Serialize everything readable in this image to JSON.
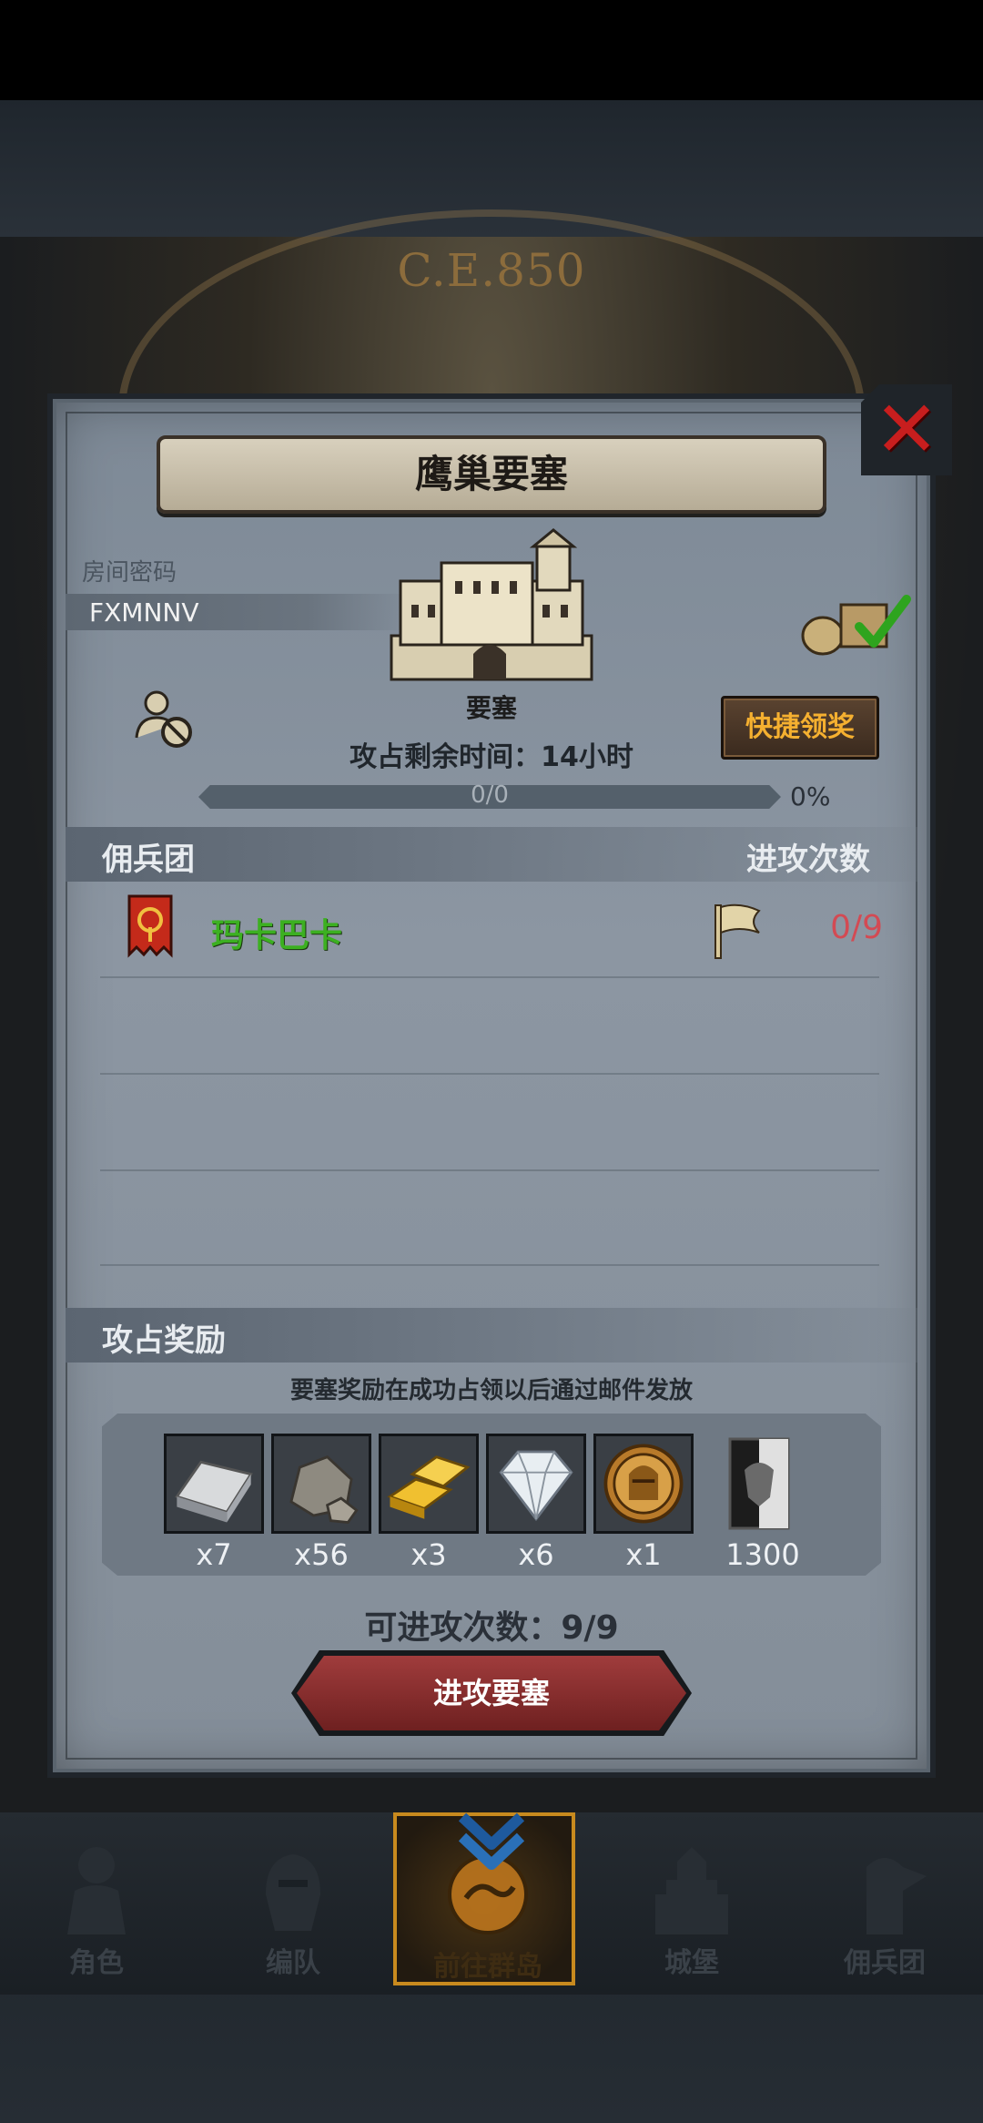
{
  "header": {
    "era": "C.E.850"
  },
  "modal": {
    "title": "鹰巢要塞",
    "room_label": "房间密码",
    "room_code": "FXMNNV",
    "fortress_label": "要塞",
    "quick_claim": "快捷领奖",
    "time_left": "攻占剩余时间：14小时",
    "progress": {
      "text": "0/0",
      "percent": "0%",
      "fraction": 0
    }
  },
  "mercenary": {
    "section_title": "佣兵团",
    "attack_count_header": "进攻次数",
    "rows": [
      {
        "name": "玛卡巴卡",
        "attacks": "0/9"
      }
    ]
  },
  "rewards": {
    "section_title": "攻占奖励",
    "note": "要塞奖励在成功占领以后通过邮件发放",
    "items": [
      {
        "icon": "iron-ingot-icon",
        "qty": "x7"
      },
      {
        "icon": "stone-icon",
        "qty": "x56"
      },
      {
        "icon": "gold-bar-icon",
        "qty": "x3"
      },
      {
        "icon": "diamond-icon",
        "qty": "x6"
      },
      {
        "icon": "knight-medal-icon",
        "qty": "x1"
      },
      {
        "icon": "faction-banner-icon",
        "qty": "1300"
      }
    ]
  },
  "remaining_attacks": "可进攻次数：9/9",
  "attack_button": "进攻要塞",
  "nav": [
    {
      "label": "角色",
      "icon": "character-icon"
    },
    {
      "label": "编队",
      "icon": "formation-icon"
    },
    {
      "label": "前往群岛",
      "icon": "islands-icon",
      "active": true
    },
    {
      "label": "城堡",
      "icon": "castle-icon"
    },
    {
      "label": "佣兵团",
      "icon": "mercenary-icon"
    }
  ],
  "colors": {
    "accent": "#c88a1e",
    "guild_name": "#3cb021",
    "attack_count": "#d34a53",
    "close": "#c81e1e"
  }
}
